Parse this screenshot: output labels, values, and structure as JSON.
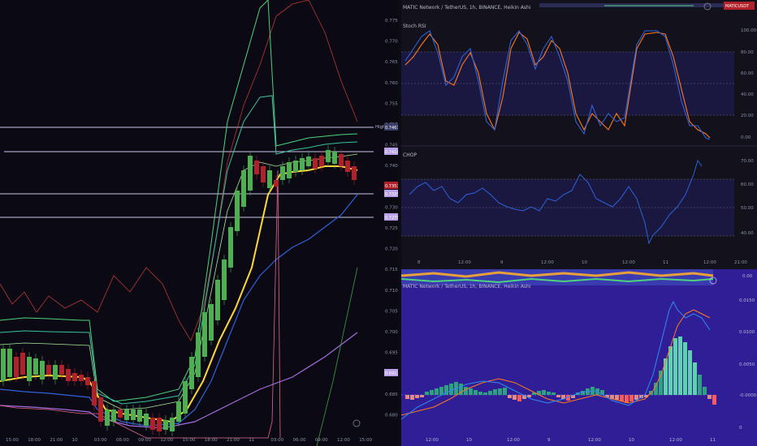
{
  "colors": {
    "left_bg": "#0b0a14",
    "top_right_bg": "#12111c",
    "bottom_right_bg": "#2f1e96",
    "bull": "#4caf50",
    "bear": "#b2202a",
    "stoch_k": "#2f62d8",
    "stoch_d": "#ff7a1f",
    "chop": "#2f62d8",
    "band_fill": "#1d1a4a"
  },
  "left_chart": {
    "price_axis": [
      "0.7750",
      "0.7700",
      "0.7650",
      "0.7600",
      "0.7550",
      "0.7500",
      "0.7450",
      "0.7400",
      "0.7350",
      "0.7300",
      "0.7250",
      "0.7200",
      "0.7150",
      "0.7100",
      "0.7050",
      "0.7000",
      "0.6950",
      "0.6900",
      "0.6850",
      "0.6800"
    ],
    "time_axis": [
      "15:00",
      "18:00",
      "21:00",
      "10",
      "03:00",
      "06:00",
      "09:00",
      "12:00",
      "15:00",
      "18:00",
      "21:00",
      "11",
      "03:00",
      "06:00",
      "09:00",
      "12:00",
      "15:00"
    ],
    "high_label": "High",
    "price_tags": [
      {
        "text": "0.7467",
        "color": "#3a3f6a"
      },
      {
        "text": "0.7418",
        "color": "#b9a2e8"
      },
      {
        "text": "0.7357",
        "color": "#b2202a"
      },
      {
        "text": "0.7325",
        "color": "#b9a2e8"
      },
      {
        "text": "0.7275",
        "color": "#b9a2e8"
      },
      {
        "text": "0.6912",
        "color": "#b9a2e8"
      }
    ]
  },
  "stoch_pane": {
    "header": "MATIC Network / TetherUS, 1h, BINANCE, Heikin Ashi",
    "badge": "MATICUSDT",
    "title": "Stoch RSI",
    "axis": [
      "100.00",
      "80.00",
      "60.00",
      "40.00",
      "20.00",
      "0.00"
    ]
  },
  "chop_pane": {
    "title": "CHOP",
    "axis": [
      "70.00",
      "60.00",
      "50.00",
      "40.00"
    ],
    "time_axis": [
      "8",
      "12:00",
      "9",
      "12:00",
      "10",
      "12:00",
      "11",
      "12:00",
      "21:00"
    ]
  },
  "macd_pane": {
    "header": "MATIC Network / TetherUS, 1h, BINANCE, Heikin Ashi",
    "top_axis": [
      "0.00"
    ],
    "axis": [
      "0.0150",
      "0.0100",
      "0.0050",
      "-0.0000",
      "0"
    ],
    "time_axis": [
      "12:00",
      "10",
      "12:00",
      "9",
      "12:00",
      "10",
      "12:00",
      "11",
      "12:00"
    ]
  }
}
